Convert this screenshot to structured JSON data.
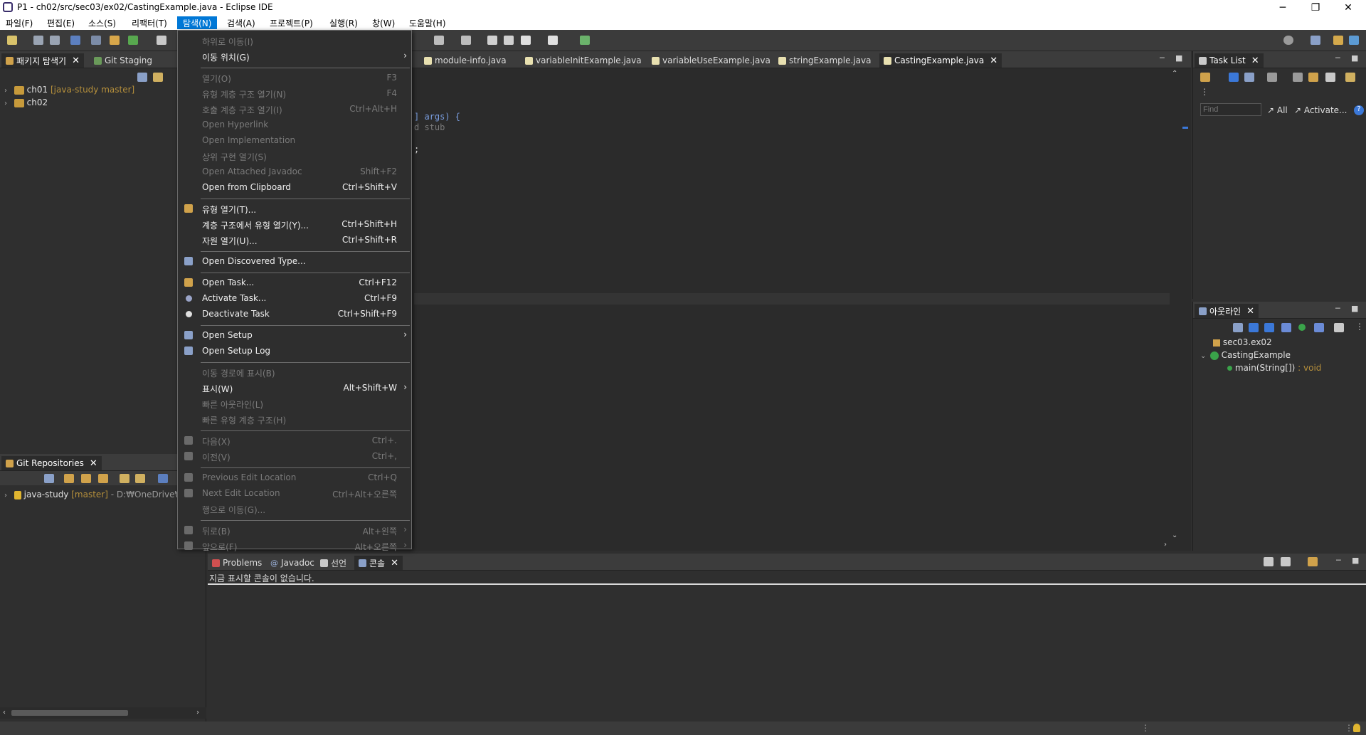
{
  "window": {
    "title": "P1 - ch02/src/sec03/ex02/CastingExample.java - Eclipse IDE",
    "controls": {
      "minimize": "─",
      "restore": "❐",
      "close": "✕"
    }
  },
  "menubar": {
    "items": [
      "파일(F)",
      "편집(E)",
      "소스(S)",
      "리팩터(T)",
      "탐색(N)",
      "검색(A)",
      "프로젝트(P)",
      "실행(R)",
      "창(W)",
      "도움말(H)"
    ],
    "active_index": 4
  },
  "package_explorer": {
    "tabs": [
      {
        "label": "패키지 탐색기",
        "selected": true
      },
      {
        "label": "Git Staging",
        "selected": false
      }
    ],
    "tree": [
      {
        "name": "ch01",
        "decoration": "[java-study master]"
      },
      {
        "name": "ch02",
        "decoration": ""
      }
    ]
  },
  "git_repositories": {
    "tab_label": "Git Repositories",
    "repo": {
      "name": "java-study",
      "branch": "[master]",
      "path": "- D:₩OneDrive₩Pr"
    }
  },
  "editor": {
    "tabs": [
      {
        "label": "module-info.java",
        "selected": false
      },
      {
        "label": "variableInitExample.java",
        "selected": false
      },
      {
        "label": "variableUseExample.java",
        "selected": false
      },
      {
        "label": "stringExample.java",
        "selected": false
      },
      {
        "label": "CastingExample.java",
        "selected": true
      }
    ],
    "visible_code": {
      "args_fragment": "] args) {",
      "stub_fragment": "d stub",
      "semicolon_fragment": ";"
    }
  },
  "navigate_menu": {
    "items": [
      {
        "label": "하위로 이동(I)",
        "shortcut": "",
        "enabled": false,
        "submenu": false
      },
      {
        "label": "이동 위치(G)",
        "shortcut": "",
        "enabled": true,
        "submenu": true
      },
      {
        "separator": true
      },
      {
        "label": "열기(O)",
        "shortcut": "F3",
        "enabled": false,
        "submenu": false
      },
      {
        "label": "유형 계층 구조 열기(N)",
        "shortcut": "F4",
        "enabled": false,
        "submenu": false
      },
      {
        "label": "호출 계층 구조 열기(I)",
        "shortcut": "Ctrl+Alt+H",
        "enabled": false,
        "submenu": false
      },
      {
        "label": "Open Hyperlink",
        "shortcut": "",
        "enabled": false,
        "submenu": false
      },
      {
        "label": "Open Implementation",
        "shortcut": "",
        "enabled": false,
        "submenu": false
      },
      {
        "label": "상위 구현 열기(S)",
        "shortcut": "",
        "enabled": false,
        "submenu": false
      },
      {
        "label": "Open Attached Javadoc",
        "shortcut": "Shift+F2",
        "enabled": false,
        "submenu": false
      },
      {
        "label": "Open from Clipboard",
        "shortcut": "Ctrl+Shift+V",
        "enabled": true,
        "submenu": false
      },
      {
        "separator": true
      },
      {
        "label": "유형 열기(T)...",
        "shortcut": "",
        "enabled": true,
        "submenu": false,
        "icon": "open-type-icon"
      },
      {
        "label": "계층 구조에서 유형 열기(Y)...",
        "shortcut": "Ctrl+Shift+H",
        "enabled": true,
        "submenu": false
      },
      {
        "label": "자원 열기(U)...",
        "shortcut": "Ctrl+Shift+R",
        "enabled": true,
        "submenu": false
      },
      {
        "separator": true
      },
      {
        "label": "Open Discovered Type...",
        "shortcut": "",
        "enabled": true,
        "submenu": false,
        "icon": "discovered-type-icon"
      },
      {
        "separator": true
      },
      {
        "label": "Open Task...",
        "shortcut": "Ctrl+F12",
        "enabled": true,
        "submenu": false,
        "icon": "open-task-icon"
      },
      {
        "label": "Activate Task...",
        "shortcut": "Ctrl+F9",
        "enabled": true,
        "submenu": false,
        "icon": "activate-task-icon"
      },
      {
        "label": "Deactivate Task",
        "shortcut": "Ctrl+Shift+F9",
        "enabled": true,
        "submenu": false,
        "icon": "deactivate-task-icon"
      },
      {
        "separator": true
      },
      {
        "label": "Open Setup",
        "shortcut": "",
        "enabled": true,
        "submenu": true,
        "icon": "open-setup-icon"
      },
      {
        "label": "Open Setup Log",
        "shortcut": "",
        "enabled": true,
        "submenu": false,
        "icon": "setup-log-icon"
      },
      {
        "separator": true
      },
      {
        "label": "이동 경로에 표시(B)",
        "shortcut": "",
        "enabled": false,
        "submenu": false
      },
      {
        "label": "표시(W)",
        "shortcut": "Alt+Shift+W",
        "enabled": true,
        "submenu": true
      },
      {
        "label": "빠른 아웃라인(L)",
        "shortcut": "",
        "enabled": false,
        "submenu": false
      },
      {
        "label": "빠른 유형 계층 구조(H)",
        "shortcut": "",
        "enabled": false,
        "submenu": false
      },
      {
        "separator": true
      },
      {
        "label": "다음(X)",
        "shortcut": "Ctrl+.",
        "enabled": false,
        "submenu": false,
        "icon": "next-annotation-icon"
      },
      {
        "label": "이전(V)",
        "shortcut": "Ctrl+,",
        "enabled": false,
        "submenu": false,
        "icon": "prev-annotation-icon"
      },
      {
        "separator": true
      },
      {
        "label": "Previous Edit Location",
        "shortcut": "Ctrl+Q",
        "enabled": false,
        "submenu": false,
        "icon": "prev-edit-icon"
      },
      {
        "label": "Next Edit Location",
        "shortcut": "Ctrl+Alt+오른쪽",
        "enabled": false,
        "submenu": false,
        "icon": "next-edit-icon"
      },
      {
        "label": "행으로 이동(G)...",
        "shortcut": "",
        "enabled": false,
        "submenu": false
      },
      {
        "separator": true
      },
      {
        "label": "뒤로(B)",
        "shortcut": "Alt+왼쪽",
        "enabled": false,
        "submenu": true,
        "icon": "back-icon"
      },
      {
        "label": "앞으로(F)",
        "shortcut": "Alt+오른쪽",
        "enabled": false,
        "submenu": true,
        "icon": "forward-icon"
      }
    ]
  },
  "task_list": {
    "tab_label": "Task List",
    "find_placeholder": "Find",
    "all_label": "All",
    "activate_label": "Activate..."
  },
  "outline": {
    "tab_label": "아웃라인",
    "items": [
      {
        "label": "sec03.ex02",
        "suffix": ""
      },
      {
        "label": "CastingExample",
        "suffix": ""
      },
      {
        "label": "main(String[])",
        "suffix": " : void"
      }
    ]
  },
  "console_panel": {
    "tabs": [
      {
        "label": "Problems",
        "selected": false
      },
      {
        "label": "Javadoc",
        "selected": false
      },
      {
        "label": "선언",
        "selected": false
      },
      {
        "label": "콘솔",
        "selected": true
      }
    ],
    "message": "지금 표시할 콘솔이 없습니다."
  },
  "colors": {
    "menu_highlight": "#0078d7",
    "panel_bg": "#2f2f2f",
    "editor_bg": "#2b2b2b",
    "branch_decoration": "#b58f3b",
    "keyword": "#7a9ee0"
  }
}
